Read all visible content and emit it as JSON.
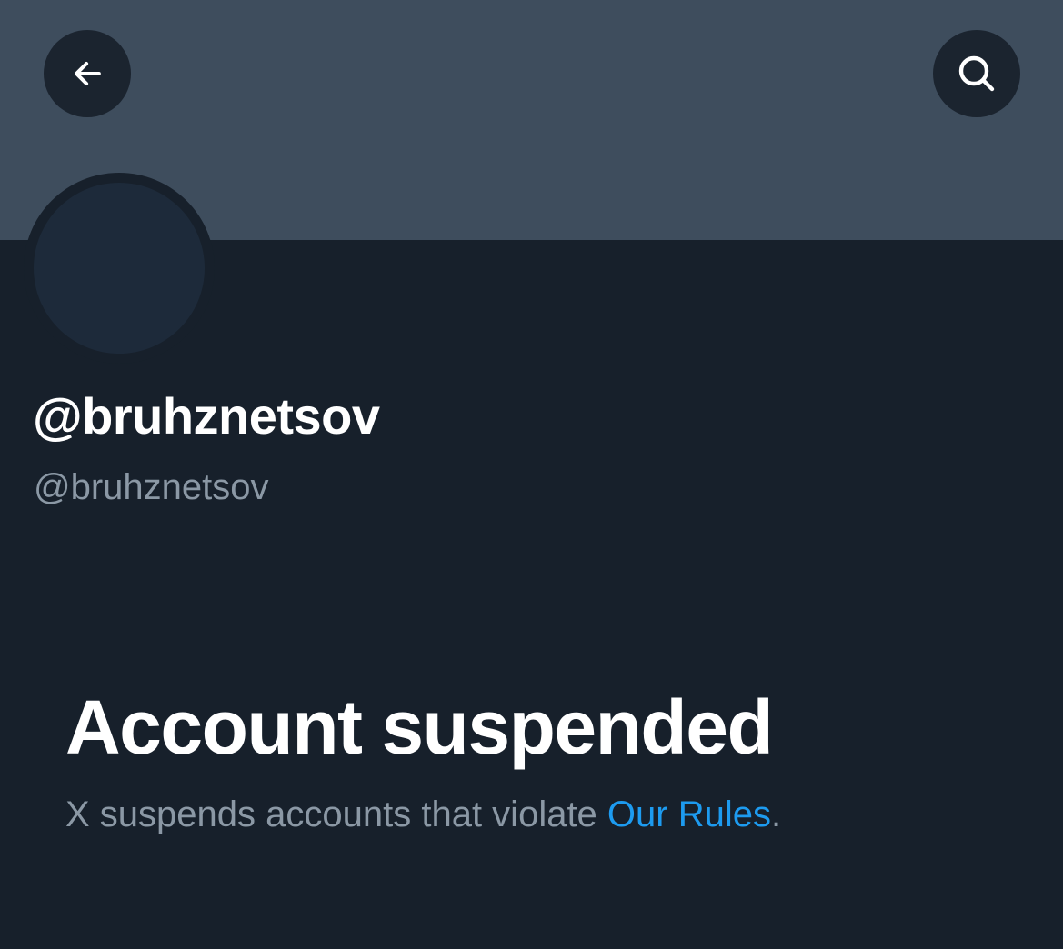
{
  "header": {
    "back_icon": "arrow-left-icon",
    "search_icon": "search-icon"
  },
  "profile": {
    "display_name": "@bruhznetsov",
    "handle": "@bruhznetsov"
  },
  "suspension": {
    "title": "Account suspended",
    "message_prefix": "X suspends accounts that violate ",
    "rules_link": "Our Rules",
    "message_suffix": "."
  },
  "colors": {
    "banner": "#3e4d5d",
    "background": "#17202b",
    "avatar": "#1d2a3a",
    "button_bg": "#1b242f",
    "muted_text": "#8b98a5",
    "link": "#1d9bf0"
  }
}
